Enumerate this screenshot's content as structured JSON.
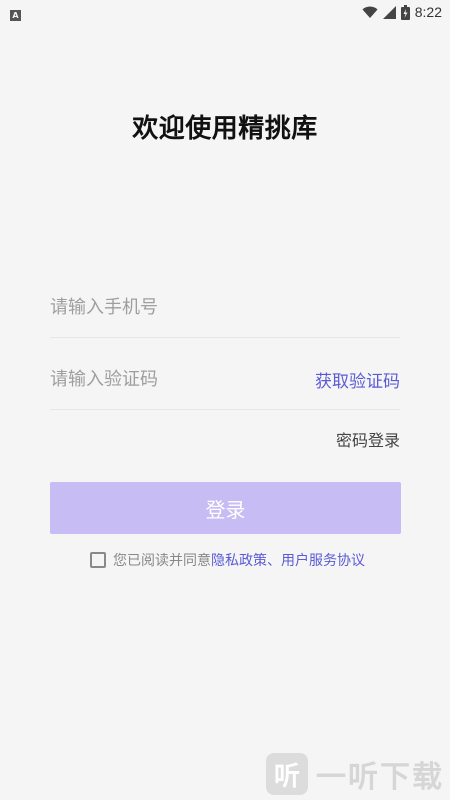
{
  "status_bar": {
    "left_icon": "A",
    "time": "8:22",
    "icons": [
      "wifi-icon",
      "cell-signal-icon",
      "battery-icon"
    ]
  },
  "title": "欢迎使用精挑库",
  "phone": {
    "placeholder": "请输入手机号",
    "value": ""
  },
  "code": {
    "placeholder": "请输入验证码",
    "value": "",
    "get_code_label": "获取验证码"
  },
  "password_login_label": "密码登录",
  "login_button_label": "登录",
  "agreement": {
    "checked": false,
    "prefix": "您已阅读并同意",
    "privacy_link": "隐私政策",
    "separator": "、",
    "service_link": "用户服务协议"
  },
  "watermark": {
    "logo_char": "听",
    "text": "一听下载"
  },
  "colors": {
    "accent": "#5b5bd6",
    "button_bg": "#c8bcf4",
    "background": "#f5f5f5"
  }
}
